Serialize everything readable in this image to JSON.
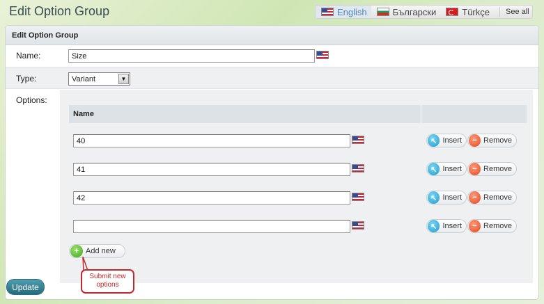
{
  "page_title": "Edit Option Group",
  "languages": [
    {
      "label": "English",
      "flag": "us-flag-icon",
      "active": true
    },
    {
      "label": "Български",
      "flag": "bg-flag-icon",
      "active": false
    },
    {
      "label": "Türkçe",
      "flag": "tr-flag-icon",
      "active": false
    }
  ],
  "see_all_label": "See all",
  "panel": {
    "header": "Edit Option Group",
    "name_label": "Name:",
    "name_value": "Size",
    "type_label": "Type:",
    "type_value": "Variant",
    "options_label": "Options:",
    "options_column_header": "Name",
    "options": [
      {
        "value": "40"
      },
      {
        "value": "41"
      },
      {
        "value": "42"
      },
      {
        "value": ""
      }
    ],
    "insert_label": "Insert",
    "remove_label": "Remove",
    "add_new_label": "Add new"
  },
  "callout_text": "Submit new options",
  "update_label": "Update",
  "colors": {
    "accent_blue": "#4f86b8",
    "update_button": "#2f7f92",
    "callout_red": "#c4262a"
  }
}
